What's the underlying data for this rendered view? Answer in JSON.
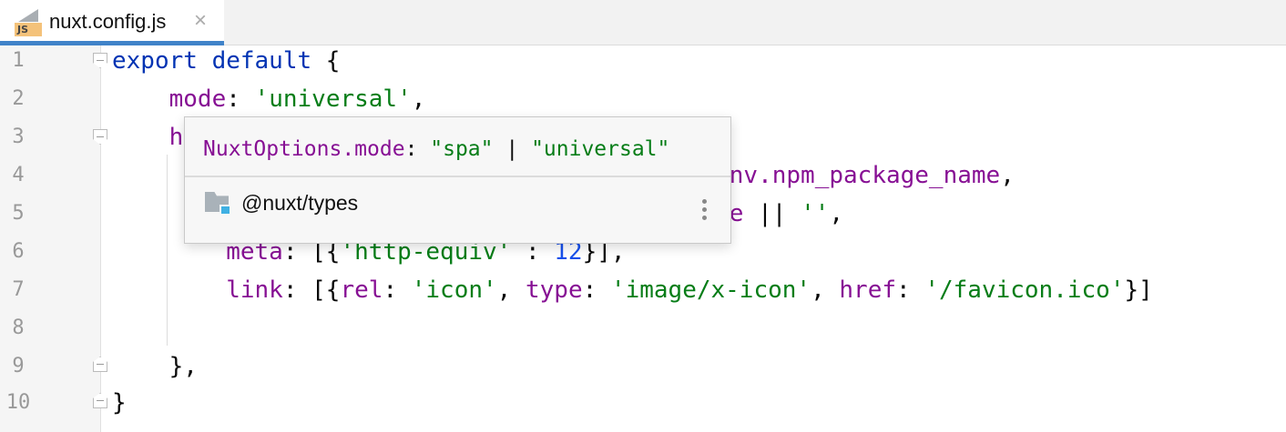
{
  "tab": {
    "label": "nuxt.config.js",
    "icon_label": "JS"
  },
  "line_numbers": [
    "1",
    "2",
    "3",
    "4",
    "5",
    "6",
    "7",
    "8",
    "9",
    "10"
  ],
  "code": {
    "l1": {
      "kw": "export default",
      "p": " {"
    },
    "l2": {
      "prop": "mode",
      "p1": ": ",
      "str": "'universal'",
      "p2": ","
    },
    "l3": {
      "prop": "h"
    },
    "l4": {
      "a": "nv.",
      "prop": "npm_package_name",
      "p": ","
    },
    "l5": {
      "prop": "e",
      "p1": " || ",
      "str": "''",
      "p2": ","
    },
    "l6": {
      "prop": "meta",
      "p1": ": [{",
      "str": "'http-equiv'",
      "p2": " : ",
      "num": "12",
      "p3": "}],"
    },
    "l7": {
      "prop": "link",
      "p1": ": [{",
      "k1": "rel",
      "p2": ": ",
      "s1": "'icon'",
      "p3": ", ",
      "k2": "type",
      "p4": ": ",
      "s2": "'image/x-icon'",
      "p5": ", ",
      "k3": "href",
      "p6": ": ",
      "s3": "'/favicon.ico'",
      "p7": "}]"
    },
    "l9": "},",
    "l10": "}"
  },
  "popup": {
    "owner": "NuxtOptions.mode",
    "sep": ": ",
    "t1": "\"spa\"",
    "bar": " | ",
    "t2": "\"universal\"",
    "package": "@nuxt/types"
  }
}
